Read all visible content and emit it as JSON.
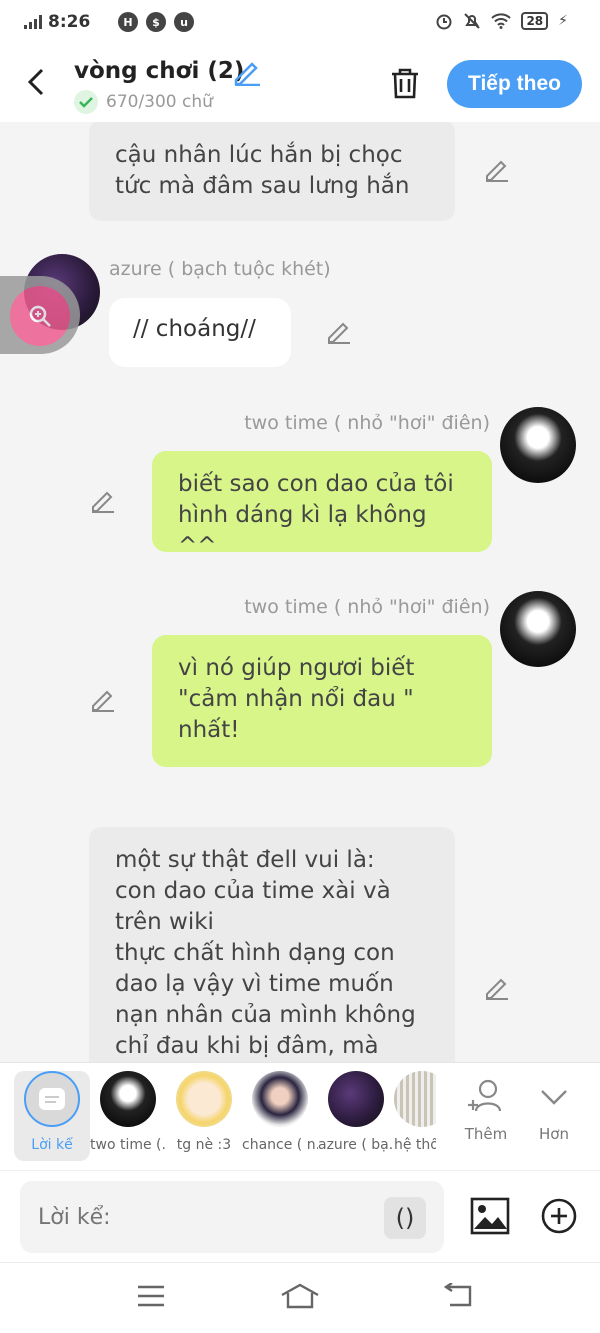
{
  "status_bar": {
    "time": "8:26",
    "battery": "28"
  },
  "header": {
    "title": "vòng chơi (2)",
    "word_count": "670/300 chữ",
    "next_label": "Tiếp theo"
  },
  "messages": [
    {
      "type": "narration",
      "text": "cậu nhân lúc hắn bị chọc\ntức mà đâm sau lưng hắn"
    },
    {
      "type": "left",
      "name": "azure ( bạch tuộc khét)",
      "text": "// choáng//"
    },
    {
      "type": "right",
      "name": "two time ( nhỏ \"hơi\" điên)",
      "text": "biết sao con dao của tôi\nhình dáng kì lạ không ^^"
    },
    {
      "type": "right",
      "name": "two time ( nhỏ \"hơi\" điên)",
      "text": "vì nó giúp ngươi biết\n\"cảm nhận nổi đau \"\nnhất!"
    },
    {
      "type": "narration",
      "text": "một sự thật đell vui là:\ncon dao của time xài và\ntrên wiki\nthực chất hình dạng con\ndao lạ vậy vì time muốn\nnạn nhân của mình không\nchỉ đau khi bị đâm, mà"
    }
  ],
  "characters": [
    {
      "label": "Lời kể",
      "icon": "narration-icon"
    },
    {
      "label": "two time (...",
      "icon": "avatar"
    },
    {
      "label": "tg nè :3",
      "icon": "avatar"
    },
    {
      "label": "chance ( n...",
      "icon": "avatar"
    },
    {
      "label": "azure ( bạ...",
      "icon": "avatar"
    },
    {
      "label": "hệ thố",
      "icon": "avatar"
    }
  ],
  "char_actions": {
    "more_label": "Thêm",
    "expand_label": "Hơn"
  },
  "input": {
    "placeholder": "Lời kể:",
    "paren": "()"
  },
  "colors": {
    "accent": "#4a9ef5",
    "green_bubble": "#d8f58a",
    "narration_bg": "#ebebeb"
  }
}
